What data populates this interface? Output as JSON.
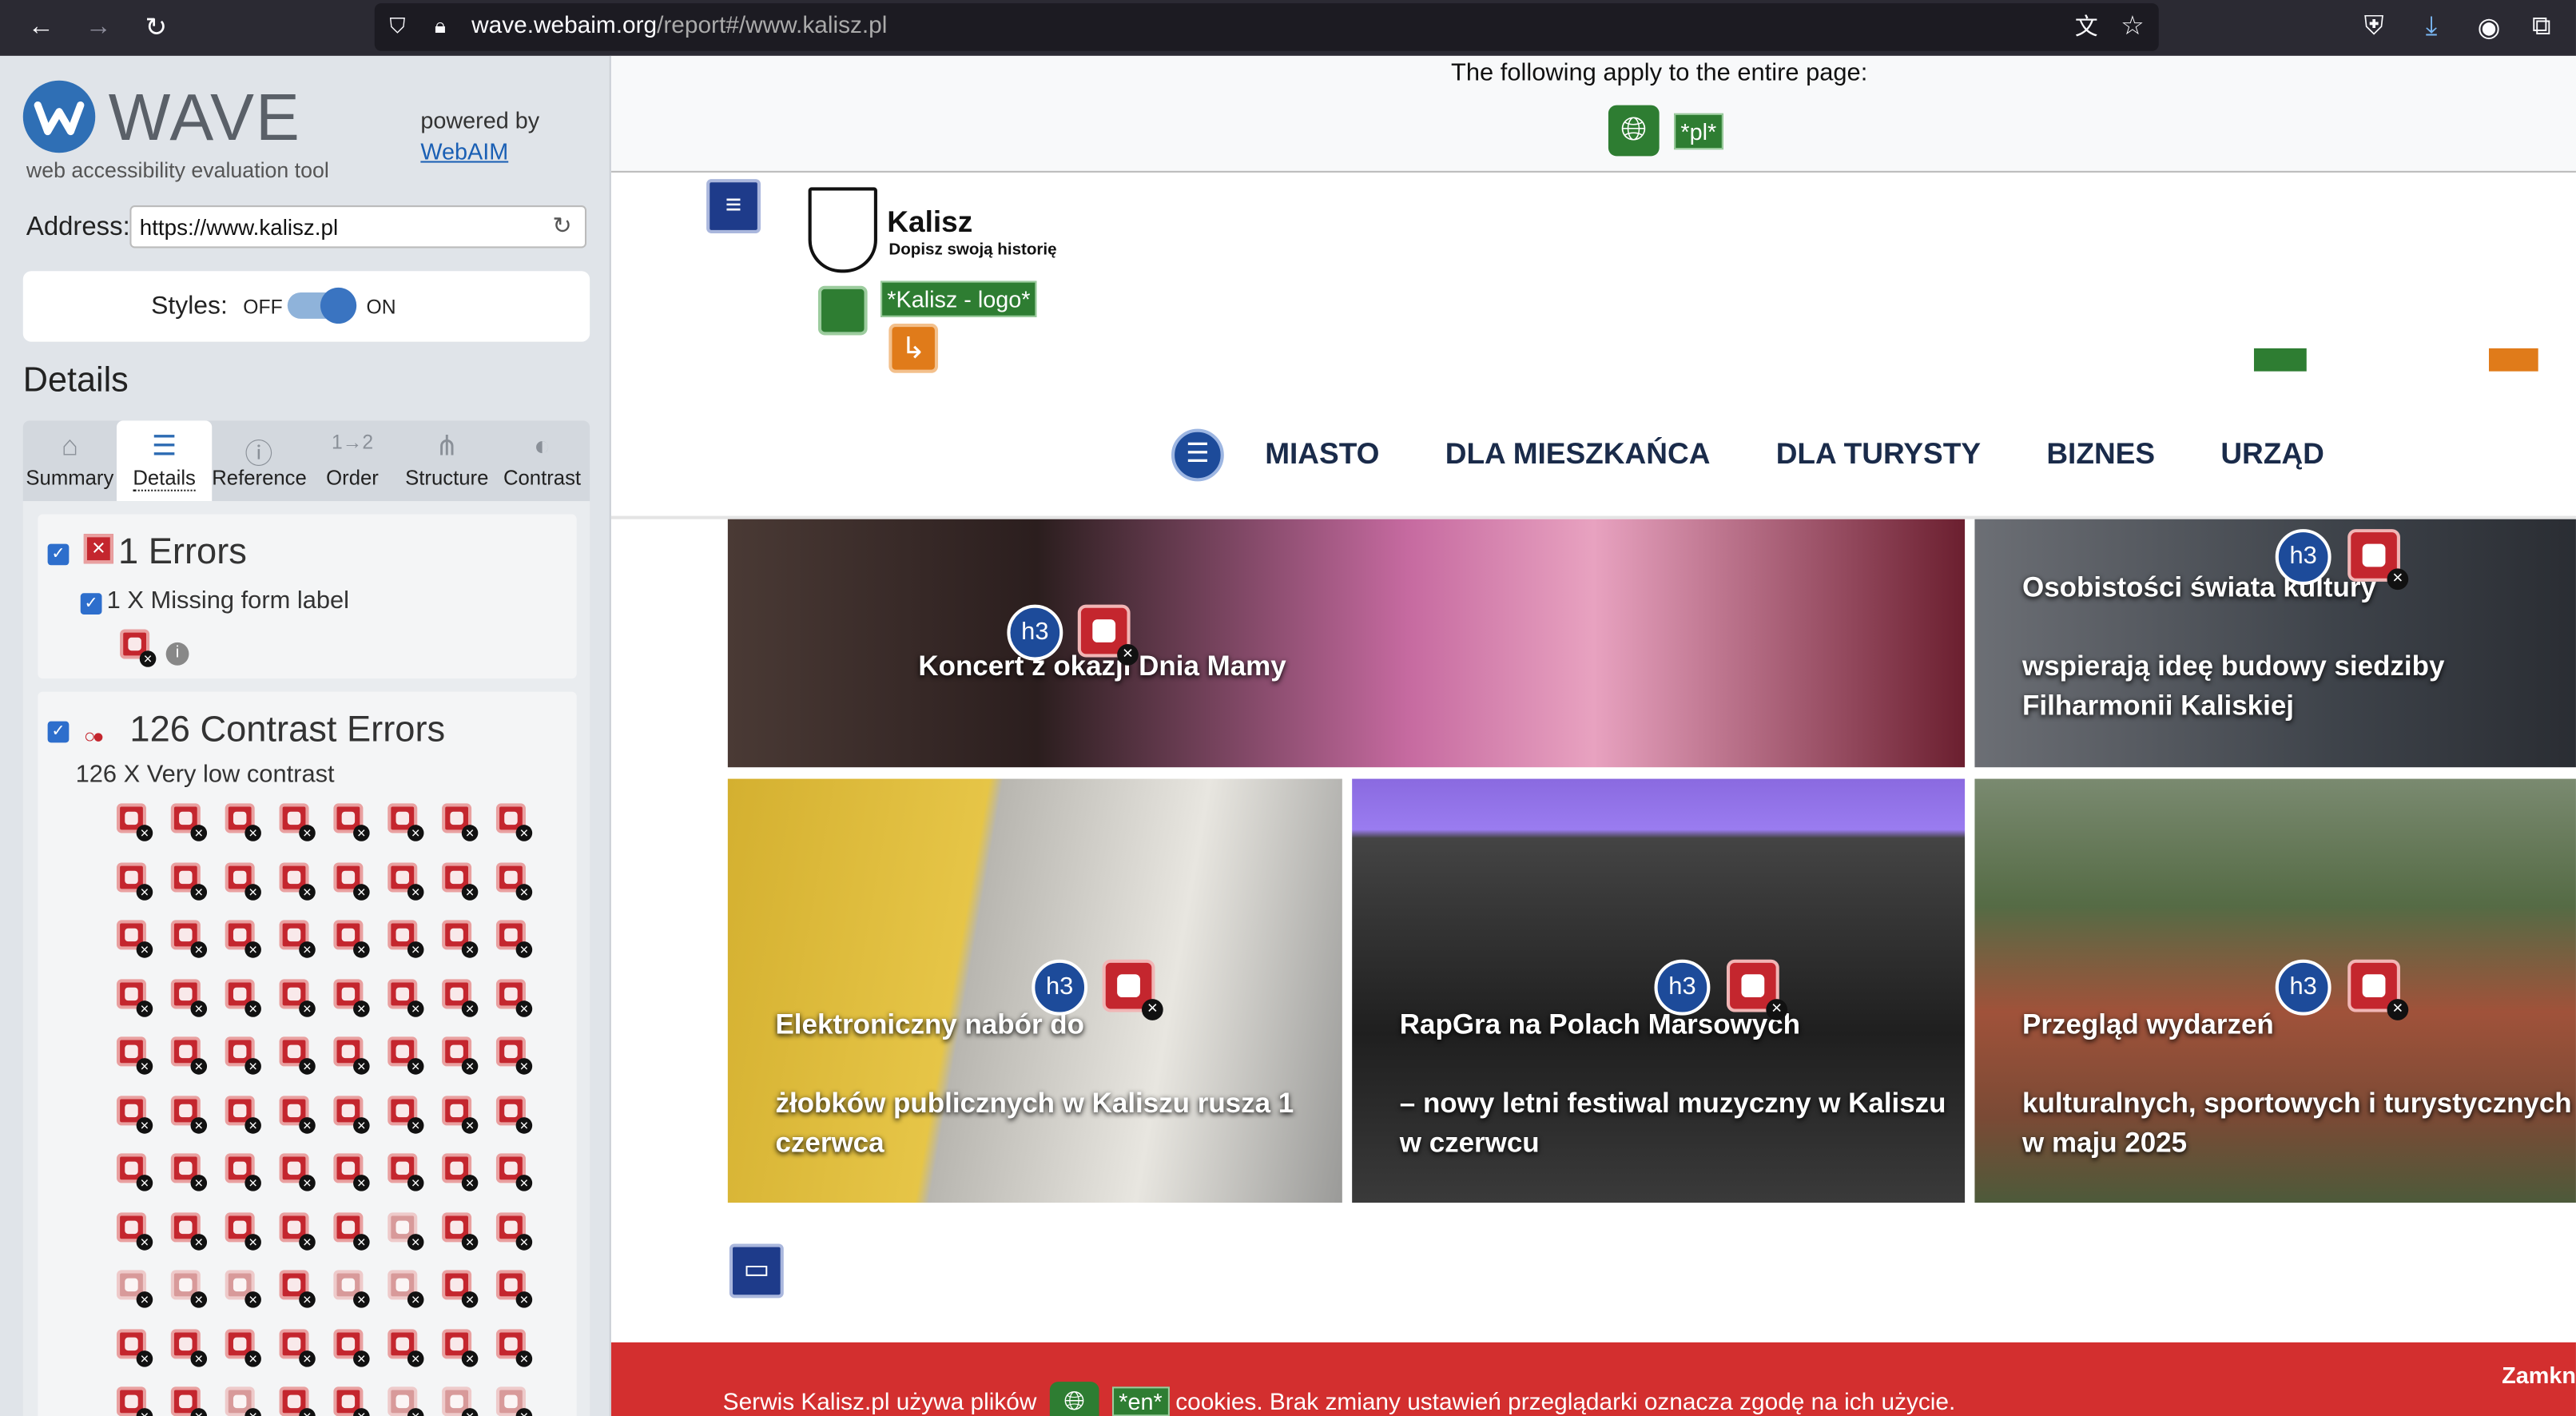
{
  "browser": {
    "url_domain": "wave.webaim.org",
    "url_path": "/report#/www.kalisz.pl",
    "back_icon": "arrow-left-icon",
    "forward_icon": "arrow-right-icon",
    "reload_icon": "reload-icon"
  },
  "wave": {
    "logo_text": "WAVE",
    "tagline": "web accessibility evaluation tool",
    "powered_by": "powered by",
    "webaim_link": "WebAIM",
    "address_label": "Address:",
    "address_value": "https://www.kalisz.pl",
    "styles_label": "Styles:",
    "styles_off": "OFF",
    "styles_on": "ON",
    "styles_enabled": true,
    "details_heading": "Details",
    "tabs": [
      {
        "label": "Summary",
        "icon": "home-icon"
      },
      {
        "label": "Details",
        "icon": "list-icon",
        "active": true
      },
      {
        "label": "Reference",
        "icon": "info-icon"
      },
      {
        "label": "Order",
        "icon": "order-icon"
      },
      {
        "label": "Structure",
        "icon": "structure-icon"
      },
      {
        "label": "Contrast",
        "icon": "contrast-icon"
      }
    ],
    "errors": {
      "heading": "1 Errors",
      "items": [
        {
          "label": "1 X Missing form label"
        }
      ]
    },
    "contrast": {
      "heading": "126 Contrast Errors",
      "subheading": "126 X Very low contrast"
    }
  },
  "page": {
    "entire_page_note": "The following apply to the entire page:",
    "lang_tag": "*pl*",
    "logo_alt_tag": "*Kalisz - logo*",
    "site_name": "Kalisz",
    "site_slogan": "Dopisz swoją historię",
    "nav": [
      "MIASTO",
      "DLA MIESZKAŃCA",
      "DLA TURYSTY",
      "BIZNES",
      "URZĄD"
    ],
    "tiles": [
      {
        "caption": "Koncert z okazji Dnia Mamy"
      },
      {
        "caption": "Osobistości świata kultury\n\nwspierają ideę budowy siedziby Filharmonii Kaliskiej"
      },
      {
        "caption": "Elektroniczny nabór do\n\nżłobków publicznych w Kaliszu rusza 1 czerwca"
      },
      {
        "caption": "RapGra na Polach Marsowych\n\n– nowy letni festiwal muzyczny w Kaliszu w czerwcu"
      },
      {
        "caption": "Przegląd wydarzeń\n\nkulturalnych, sportowych i turystycznych w maju 2025"
      }
    ],
    "heading_badge": "h3",
    "cookie_text_1": "Serwis Kalisz.pl używa plików",
    "cookie_lang_tag": "*en*",
    "cookie_text_2": "cookies. Brak zmiany ustawień przeglądarki oznacza zgodę na ich użycie.",
    "cookie_close": "Zamkn"
  },
  "colors": {
    "wave_blue": "#2f6fb5",
    "error_red": "#c4262e",
    "feature_green": "#2e7d32",
    "cookie_red": "#d32f2f"
  }
}
